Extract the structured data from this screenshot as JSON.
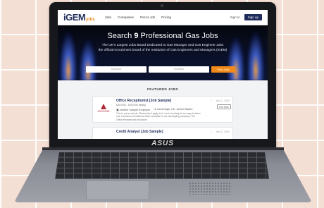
{
  "brand": {
    "logo_main": "iGEM",
    "logo_sub": "jobs",
    "laptop_logo": "ASUS"
  },
  "nav": [
    "Jobs",
    "Companies",
    "Post a Job",
    "Pricing"
  ],
  "auth": {
    "sign_in": "Sign In",
    "sign_up": "Sign up"
  },
  "hero": {
    "title_prefix": "Search",
    "count": "9",
    "title_suffix": "Professional Gas Jobs",
    "subtitle_line1": "The UK's Largest Jobs Board Dedicated to Gas Manager and Gas Engineer Jobs",
    "subtitle_line2": "the official recruitment board of the Institution of Gas Engineers and Managers (IGEM)"
  },
  "search": {
    "keyword_placeholder": "Keyword",
    "location_placeholder": "Location",
    "button": "Find Jobs"
  },
  "featured_heading": "FEATURED JOBS",
  "jobs": [
    {
      "title": "Office Receptionist [Job Sample]",
      "salary": "£20,000 - £25,000 yearly",
      "company": "Jardine Sample Employer",
      "location": "Cambridge, UK, United States",
      "description": "This is not a real job. Please don't apply to it. You're looking for an easy-to-learn role, business-to-business office reception in our developing company. The Office Receptionist should be",
      "company_logo_text": "JARDINE",
      "date": "Jan 22, 2019",
      "badge": "Full Time"
    },
    {
      "title": "Credit Analyst [Job Sample]",
      "date": "Jan 22, 2019"
    }
  ],
  "icons": {
    "star": "star-icon",
    "building": "building-icon",
    "location": "location-pin-icon"
  },
  "colors": {
    "brand_navy": "#1f2c5c",
    "brand_orange": "#f28a1a",
    "company_red": "#b22b3a"
  }
}
